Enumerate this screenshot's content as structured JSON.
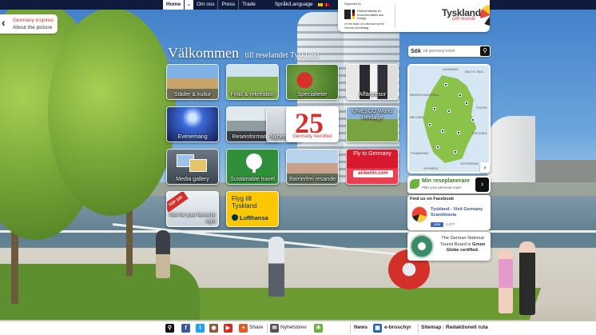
{
  "topnav": {
    "home": "Home",
    "links": [
      "Om oss",
      "Press",
      "Trade"
    ],
    "language": "Språk/Language"
  },
  "logo": {
    "sponsor_note": "Supported by",
    "government_line": "Federal Ministry for Economic Affairs and Energy",
    "sponsor_basis": "on the basis of a decision by the German Bundestag",
    "brand": "Tyskland",
    "slogan": "Ditt resmål"
  },
  "inspires": {
    "title": "Germany inspires",
    "subtitle": "About the picture"
  },
  "welcome": {
    "big": "Välkommen",
    "small": "till reselandet Tyskland"
  },
  "search": {
    "label": "Sök",
    "placeholder": "på germany.travel"
  },
  "tiles": [
    {
      "label": "Städer & kultur"
    },
    {
      "label": "Fritid & rekreation"
    },
    {
      "label": "Specialteter"
    },
    {
      "label": "Affärsresor"
    },
    {
      "label": "Evenemang"
    },
    {
      "label": "Reseinformation"
    },
    {
      "label": "Nyhetsbrev"
    },
    {
      "label": "Germany reunified",
      "badge": "25"
    },
    {
      "label": "UNESCO World Heritage"
    },
    {
      "label": "Media gallery"
    },
    {
      "label": "Sustainable travel"
    },
    {
      "label": "Barrierfrei resande"
    },
    {
      "label": "Fly to Germany",
      "sub": "airberlin.com"
    },
    {
      "label": "Vote for your favourite sight",
      "badge": "TOP 100"
    },
    {
      "label": "Flyg till Tyskland",
      "sub": "Lufthansa"
    }
  ],
  "map": {
    "labels": [
      "Danmark",
      "Baltic Sea",
      "Polen",
      "Tjeckien",
      "Österrike",
      "Schweiz",
      "Frankrike",
      "Belgien",
      "Nederländerna"
    ]
  },
  "planner": {
    "title": "Min reseplanerare",
    "subtitle": "Plan your personal route"
  },
  "facebook": {
    "heading": "Find us on Facebook",
    "page_name": "Tyskland - Visit Germany Scandinavia",
    "like": "Like",
    "count": "1,477"
  },
  "green_globe": {
    "text_prefix": "The German National Tourist Board is ",
    "text_bold": "Green Globe certified."
  },
  "bottombar": {
    "share": "Share",
    "newsletter": "Nyhetsbrev",
    "news": "News",
    "brochures": "e-broschyr",
    "sitemap": "Sitemap",
    "legal": "Redaktionell ruta"
  },
  "colors": {
    "navy": "#0e1b3d",
    "brand_red": "#cc3333",
    "planner_green": "#3a7d1e",
    "facebook_blue": "#3b5998"
  }
}
